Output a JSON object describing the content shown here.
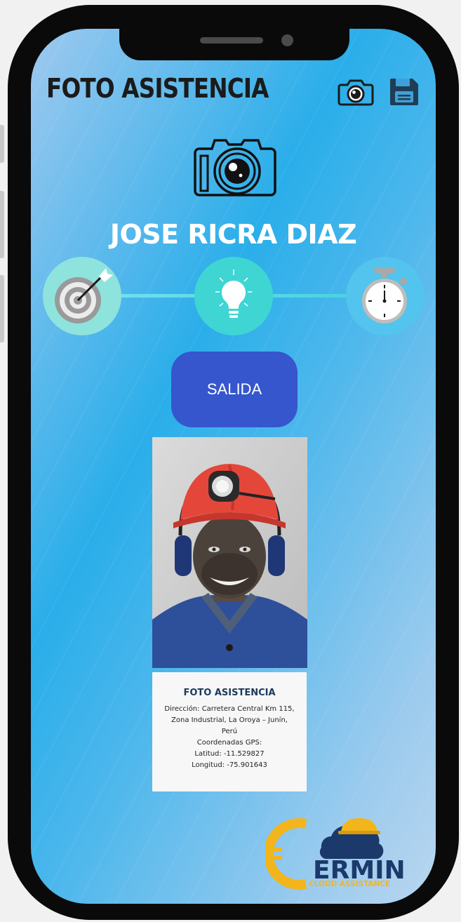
{
  "header": {
    "title": "FOTO ASISTENCIA"
  },
  "toolbar": {
    "camera_icon": "camera-icon",
    "save_icon": "save-icon"
  },
  "main": {
    "hero_icon": "camera-icon",
    "employee_name": "JOSE RICRA DIAZ",
    "steps": [
      {
        "icon": "target-icon",
        "color": "#8fe3dd"
      },
      {
        "icon": "lightbulb-icon",
        "color": "#3fd5d3"
      },
      {
        "icon": "stopwatch-icon",
        "color": "#52c4ee"
      }
    ],
    "action_button": "SALIDA",
    "action_color": "#3556cc"
  },
  "photo_card": {
    "title": "FOTO ASISTENCIA",
    "address": "Dirección: Carretera Central Km 115,\nZona Industrial, La Oroya – Junín,\nPerú",
    "gps_label": "Coordenadas GPS:",
    "latitude": "Latitud: -11.529827",
    "longitude": "Longitud: -75.901643"
  },
  "logo": {
    "name": "ERMIN",
    "tagline": "CLOUD ASSISTANCE"
  },
  "colors": {
    "accent": "#3556cc",
    "logo_gold": "#f2b51c",
    "logo_navy": "#1b3a6b"
  }
}
